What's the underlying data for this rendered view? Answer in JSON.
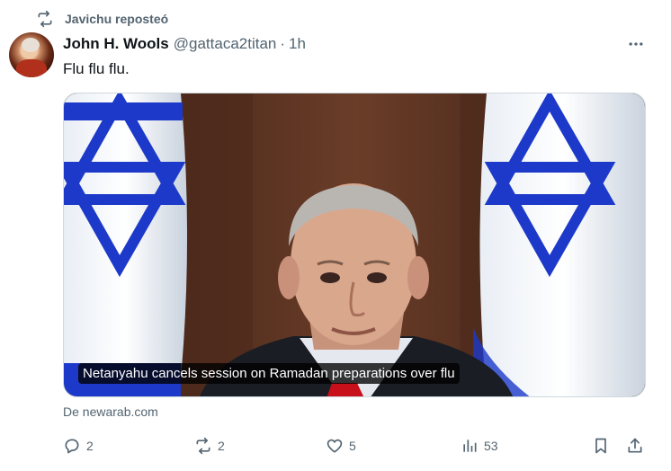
{
  "repost": {
    "text": "Javichu reposteó",
    "icon": "repost-icon"
  },
  "author": {
    "name": "John H. Wools",
    "handle": "@gattaca2titan",
    "separator": "·",
    "time": "1h"
  },
  "tweet": {
    "text": "Flu flu flu."
  },
  "media": {
    "caption": "Netanyahu cancels session on Ramadan preparations over flu"
  },
  "source": {
    "text": "De newarab.com"
  },
  "actions": {
    "reply_count": "2",
    "repost_count": "2",
    "like_count": "5",
    "views_count": "53"
  },
  "colors": {
    "secondary_text": "#536471",
    "primary_text": "#0f1419",
    "flag_blue": "#1c39c9"
  }
}
